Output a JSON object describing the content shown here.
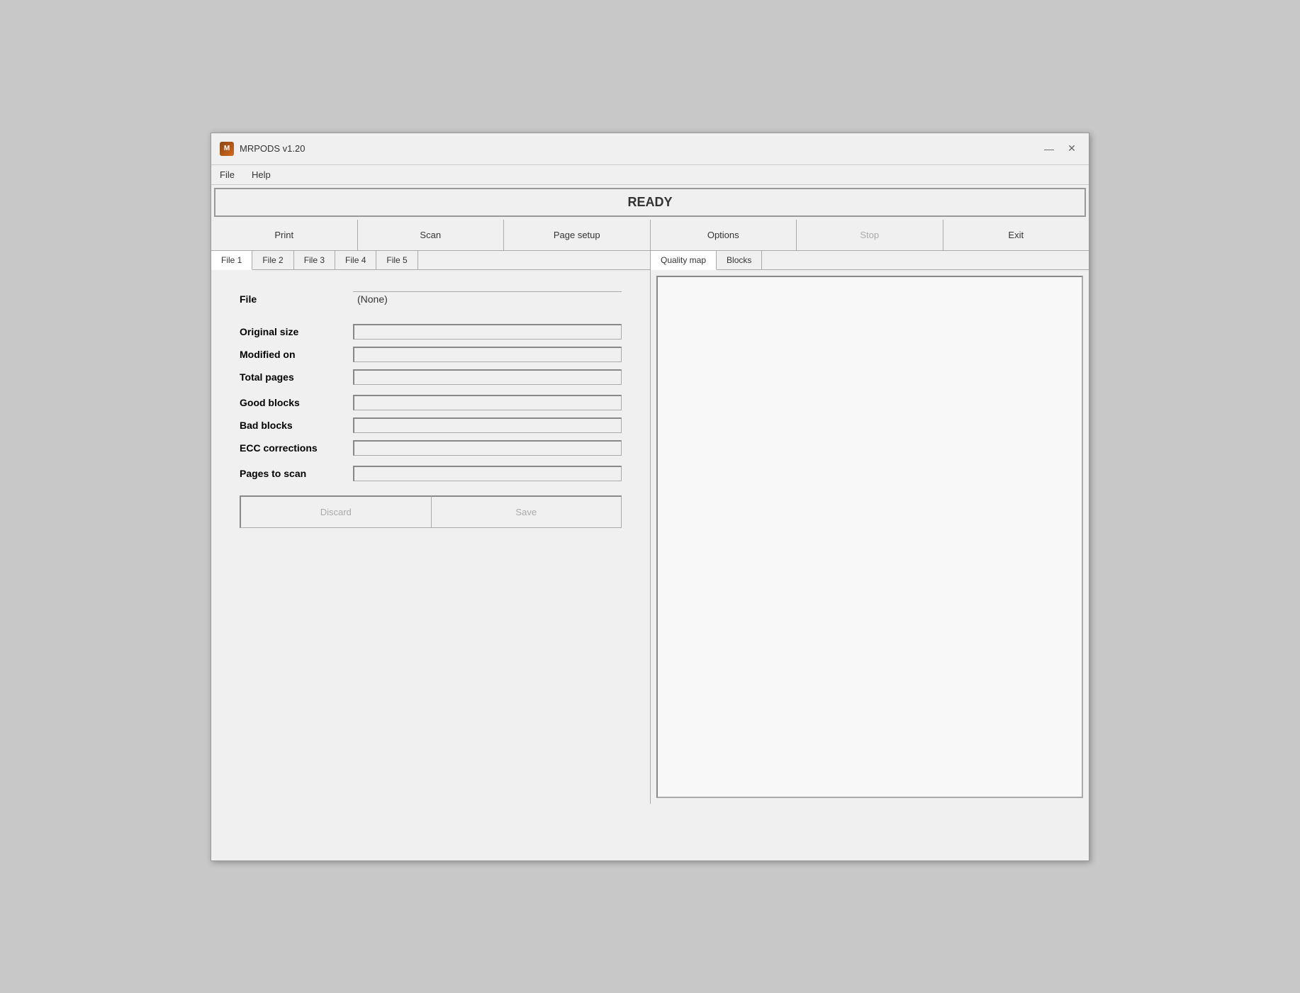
{
  "app": {
    "title": "MRPODS v1.20",
    "icon": "M"
  },
  "title_controls": {
    "minimize": "—",
    "close": "✕"
  },
  "menu": {
    "items": [
      "File",
      "Help"
    ]
  },
  "status": {
    "text": "READY"
  },
  "toolbar": {
    "buttons": [
      {
        "label": "Print",
        "name": "print-button",
        "disabled": false
      },
      {
        "label": "Scan",
        "name": "scan-button",
        "disabled": false
      },
      {
        "label": "Page setup",
        "name": "page-setup-button",
        "disabled": false
      },
      {
        "label": "Options",
        "name": "options-button",
        "disabled": false
      },
      {
        "label": "Stop",
        "name": "stop-button",
        "disabled": true
      },
      {
        "label": "Exit",
        "name": "exit-button",
        "disabled": false
      }
    ]
  },
  "file_tabs": [
    {
      "label": "File 1",
      "active": true
    },
    {
      "label": "File 2",
      "active": false
    },
    {
      "label": "File 3",
      "active": false
    },
    {
      "label": "File 4",
      "active": false
    },
    {
      "label": "File 5",
      "active": false
    }
  ],
  "right_tabs": [
    {
      "label": "Quality map",
      "active": true
    },
    {
      "label": "Blocks",
      "active": false
    }
  ],
  "fields": {
    "file": {
      "label": "File",
      "value": "(None)"
    },
    "original_size": {
      "label": "Original size",
      "value": ""
    },
    "modified_on": {
      "label": "Modified on",
      "value": ""
    },
    "total_pages": {
      "label": "Total pages",
      "value": ""
    },
    "good_blocks": {
      "label": "Good blocks",
      "value": ""
    },
    "bad_blocks": {
      "label": "Bad blocks",
      "value": ""
    },
    "ecc_corrections": {
      "label": "ECC corrections",
      "value": ""
    },
    "pages_to_scan": {
      "label": "Pages to scan",
      "value": ""
    }
  },
  "action_buttons": {
    "discard": "Discard",
    "save": "Save"
  }
}
